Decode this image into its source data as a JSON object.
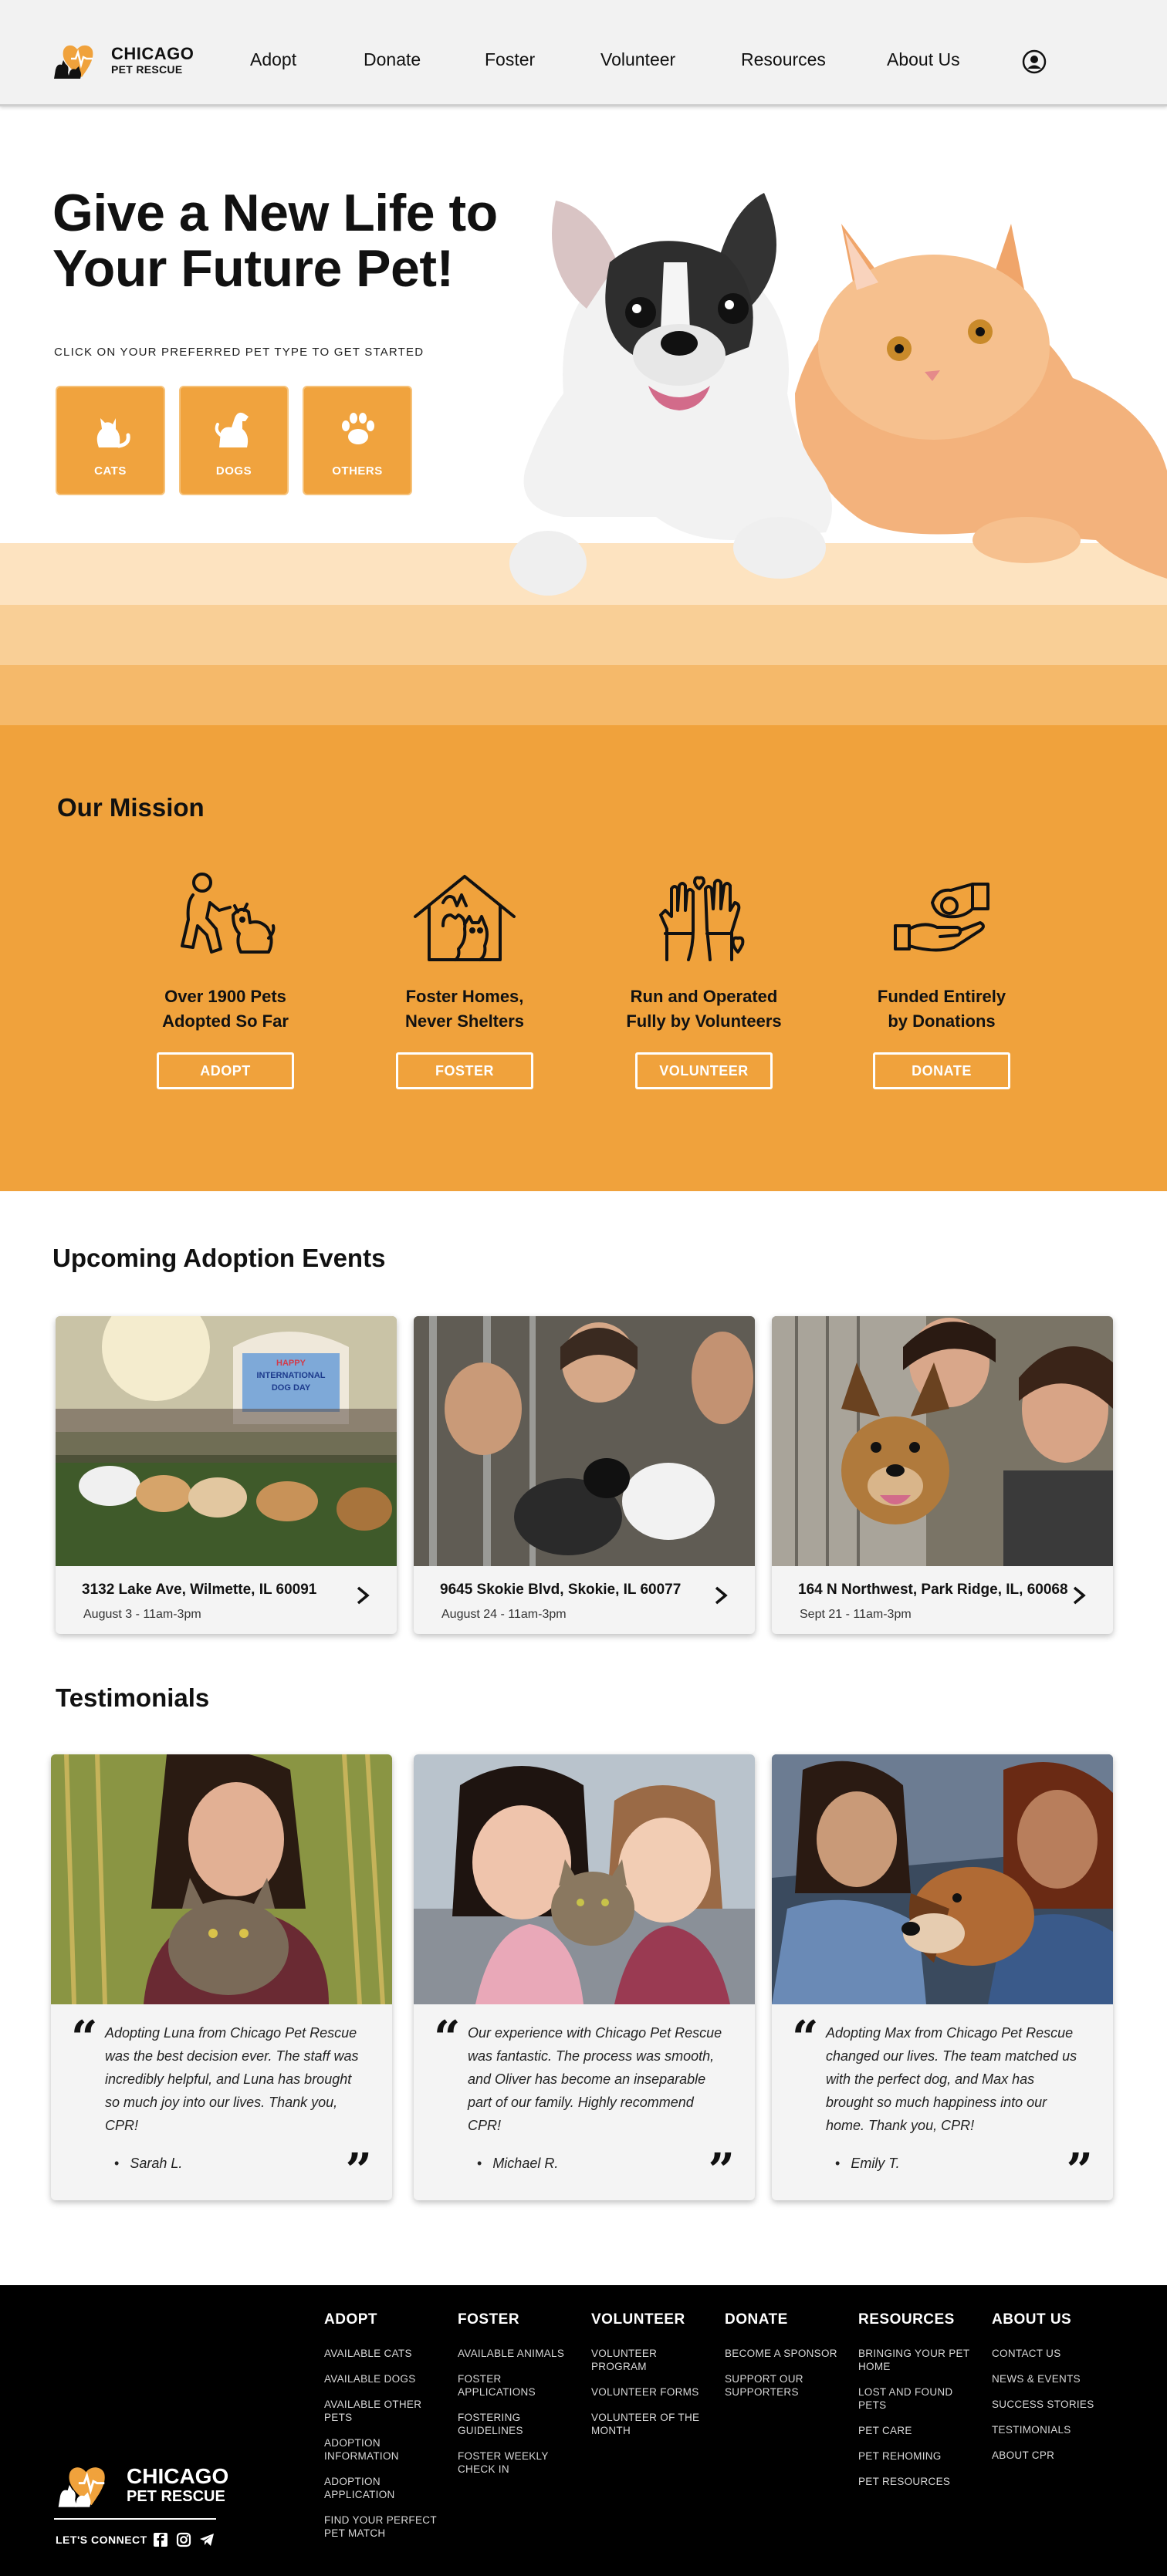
{
  "brand": {
    "name_line1": "CHICAGO",
    "name_line2": "PET RESCUE",
    "accent_orange": "#f0a23c",
    "peach_light": "#fde3c0",
    "peach_mid": "#f9cf96",
    "peach_dark": "#f5b96a"
  },
  "nav": {
    "items": [
      "Adopt",
      "Donate",
      "Foster",
      "Volunteer",
      "Resources",
      "About Us"
    ],
    "account_icon": "user-circle-icon"
  },
  "hero": {
    "title": "Give a New Life to Your Future Pet!",
    "subtitle": "CLICK ON YOUR PREFERRED PET TYPE TO GET STARTED",
    "pet_types": [
      {
        "label": "CATS",
        "icon": "cat-icon"
      },
      {
        "label": "DOGS",
        "icon": "dog-icon"
      },
      {
        "label": "OTHERS",
        "icon": "paw-icon"
      }
    ],
    "image": "dog-and-cat-photo"
  },
  "mission": {
    "title": "Our Mission",
    "items": [
      {
        "text_line1": "Over 1900 Pets",
        "text_line2": "Adopted So Far",
        "button": "ADOPT",
        "icon": "person-with-dog-icon"
      },
      {
        "text_line1": "Foster Homes,",
        "text_line2": "Never Shelters",
        "button": "FOSTER",
        "icon": "house-with-pets-icon"
      },
      {
        "text_line1": "Run and Operated",
        "text_line2": "Fully by Volunteers",
        "button": "VOLUNTEER",
        "icon": "raised-hands-icon"
      },
      {
        "text_line1": "Funded Entirely",
        "text_line2": "by Donations",
        "button": "DONATE",
        "icon": "donation-hand-icon"
      }
    ]
  },
  "events": {
    "title": "Upcoming Adoption Events",
    "items": [
      {
        "address": "3132 Lake Ave, Wilmette, IL 60091",
        "date": "August 3 - 11am-3pm",
        "banner_line1": "HAPPY",
        "banner_line2": "INTERNATIONAL",
        "banner_line3": "DOG DAY"
      },
      {
        "address": "9645 Skokie Blvd, Skokie, IL 60077",
        "date": "August 24 - 11am-3pm"
      },
      {
        "address": "164 N Northwest, Park Ridge, IL, 60068",
        "date": "Sept 21 - 11am-3pm"
      }
    ]
  },
  "testimonials": {
    "title": "Testimonials",
    "items": [
      {
        "quote": "Adopting Luna from Chicago Pet Rescue was the best decision ever. The staff was incredibly helpful, and Luna has brought so much joy into our lives. Thank you, CPR!",
        "name": "Sarah L."
      },
      {
        "quote": "Our experience with Chicago Pet Rescue was fantastic. The process was smooth, and Oliver has become an inseparable part of our family. Highly recommend CPR!",
        "name": "Michael R."
      },
      {
        "quote": "Adopting Max from Chicago Pet Rescue changed our lives. The team matched us with the perfect dog, and Max has brought so much happiness into our home. Thank you, CPR!",
        "name": "Emily T."
      }
    ]
  },
  "footer": {
    "columns": [
      {
        "heading": "ADOPT",
        "items": [
          "AVAILABLE CATS",
          "AVAILABLE DOGS",
          "AVAILABLE OTHER PETS",
          "ADOPTION INFORMATION",
          "ADOPTION APPLICATION",
          "FIND YOUR PERFECT PET MATCH"
        ]
      },
      {
        "heading": "FOSTER",
        "items": [
          "AVAILABLE ANIMALS",
          "FOSTER APPLICATIONS",
          "FOSTERING GUIDELINES",
          "FOSTER WEEKLY CHECK IN"
        ]
      },
      {
        "heading": "VOLUNTEER",
        "items": [
          "VOLUNTEER PROGRAM",
          "VOLUNTEER FORMS",
          "VOLUNTEER OF THE MONTH"
        ]
      },
      {
        "heading": "DONATE",
        "items": [
          "BECOME A SPONSOR",
          "SUPPORT OUR SUPPORTERS"
        ]
      },
      {
        "heading": "RESOURCES",
        "items": [
          "BRINGING YOUR PET HOME",
          "LOST AND FOUND PETS",
          "PET CARE",
          "PET REHOMING",
          "PET RESOURCES"
        ]
      },
      {
        "heading": "ABOUT US",
        "items": [
          "CONTACT US",
          "NEWS & EVENTS",
          "SUCCESS STORIES",
          "TESTIMONIALS",
          "ABOUT CPR"
        ]
      }
    ],
    "connect_label": "LET'S CONNECT",
    "social_icons": [
      "facebook-icon",
      "instagram-icon",
      "telegram-icon"
    ]
  }
}
